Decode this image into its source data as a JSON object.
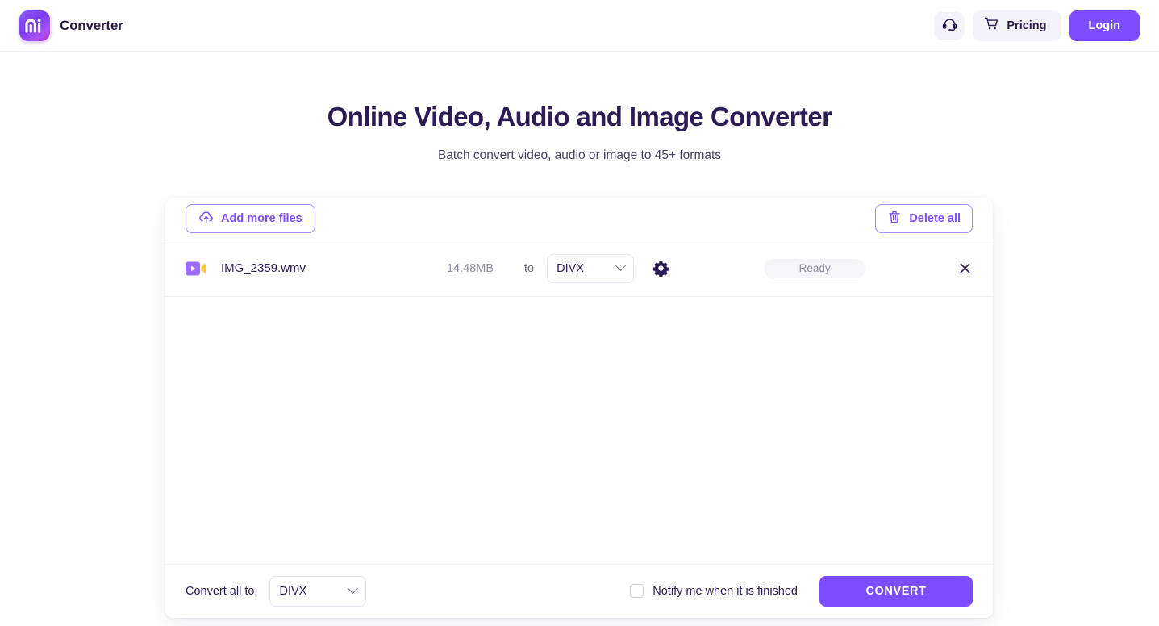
{
  "header": {
    "brand_name": "Converter",
    "logo_text": "mi",
    "support_icon": "headset-icon",
    "pricing_label": "Pricing",
    "pricing_icon": "shopping-cart-icon",
    "login_label": "Login",
    "accent_color": "#7c4dff"
  },
  "hero": {
    "title": "Online Video, Audio and Image Converter",
    "subtitle": "Batch convert video, audio or image to 45+ formats"
  },
  "toolbar": {
    "add_files_label": "Add more files",
    "add_files_icon": "cloud-upload-icon",
    "delete_all_label": "Delete all",
    "delete_all_icon": "trash-icon"
  },
  "file_row": {
    "file_icon": "video-file-icon",
    "name": "IMG_2359.wmv",
    "size": "14.48MB",
    "to_label": "to",
    "format": "DIVX",
    "settings_icon": "gear-icon",
    "status": "Ready",
    "remove_icon": "close-icon"
  },
  "bottom_bar": {
    "convert_all_label": "Convert all to:",
    "convert_all_format": "DIVX",
    "notify_label": "Notify me when it is finished",
    "notify_checked": false,
    "convert_label": "CONVERT"
  }
}
